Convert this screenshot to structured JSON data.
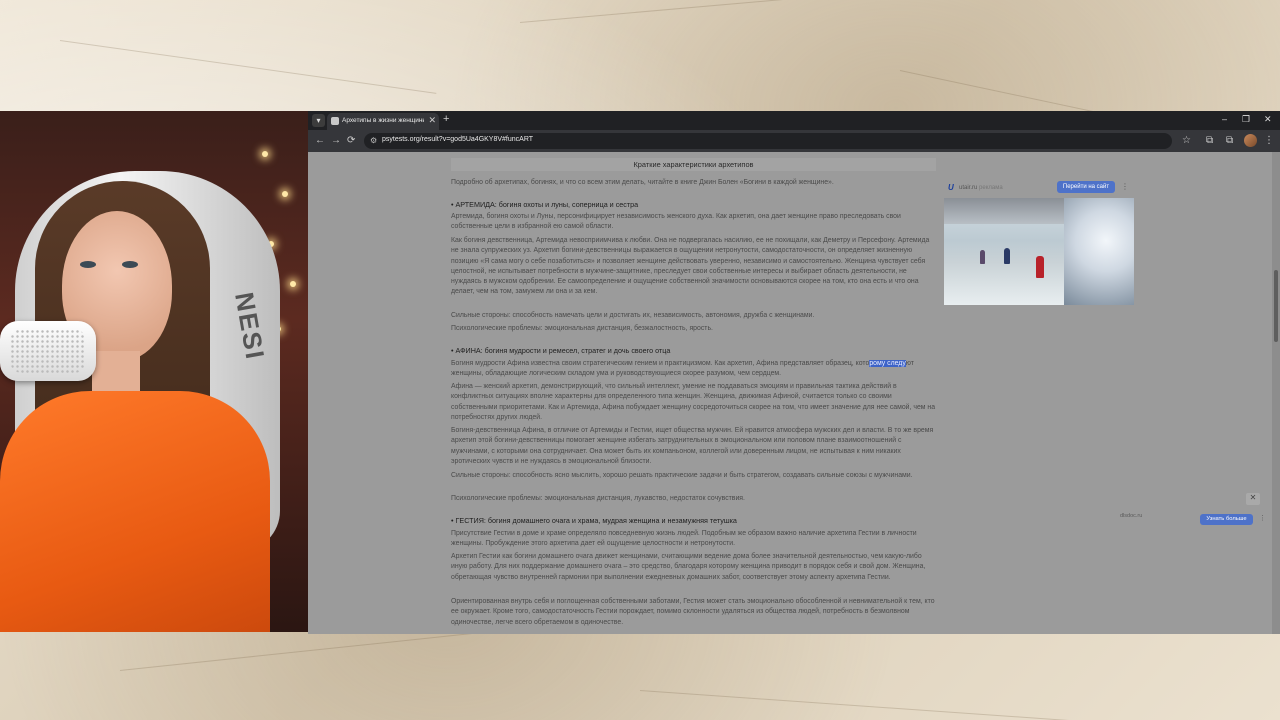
{
  "browser": {
    "tab_title": "Архетипы в жизни женщины...",
    "url": "psytests.org/result?v=god5Ua4GKY8V#funcART"
  },
  "article": {
    "heading": "Краткие характеристики архетипов",
    "intro": "Подробно об архетипах, богинях, и что со всем этим делать, читайте в книге Джин Болен «Богини в каждой женщине».",
    "sections": [
      {
        "title": "• АРТЕМИДА: богиня охоты и луны, соперница и сестра",
        "paragraphs": [
          "Артемида, богиня охоты и Луны, персонифицирует независимость женского духа. Как архетип, она дает женщине право преследовать свои собственные цели в избранной ею самой области.",
          "Как богиня девственница, Артемида невосприимчива к любви. Она не подвергалась насилию, ее не похищали, как Деметру и Персефону. Артемида не знала супружеских уз. Архетип богини-девственницы выражается в ощущении нетронутости, самодостаточности, он определяет жизненную позицию «Я сама могу о себе позаботиться» и позволяет женщине действовать уверенно, независимо и самостоятельно. Женщина чувствует себя целостной, не испытывает потребности в мужчине-защитнике, преследует свои собственные интересы и выбирает область деятельности, не нуждаясь в мужском одобрении. Ее самоопределение и ощущение собственной значимости основываются скорее на том, кто она есть и что она делает, чем на том, замужем ли она и за кем.",
          "Сильные стороны: способность намечать цели и достигать их, независимость, автономия, дружба с женщинами.",
          "Психологические проблемы: эмоциональная дистанция, безжалостность, ярость."
        ]
      },
      {
        "title": "• АФИНА: богиня мудрости и ремесел, стратег и дочь своего отца",
        "paragraphs": [
          "Богиня мудрости Афина известна своим стратегическим гением и практицизмом. Как архетип, Афина представляет образец, которому следуют женщины, обладающие логическим складом ума и руководствующиеся скорее разумом, чем сердцем.",
          "Афина — женский архетип, демонстрирующий, что сильный интеллект, умение не поддаваться эмоциям и правильная тактика действий в конфликтных ситуациях вполне характерны для определенного типа женщин. Женщина, движимая Афиной, считается только со своими собственными приоритетами. Как и Артемида, Афина побуждает женщину сосредоточиться скорее на том, что имеет значение для нее самой, чем на потребностях других людей.",
          "Богиня-девственница Афина, в отличие от Артемиды и Гестии, ищет общества мужчин. Ей нравится атмосфера мужских дел и власти. В то же время архетип этой богини-девственницы помогает женщине избегать затруднительных в эмоциональном или половом плане взаимоотношений с мужчинами, с которыми она сотрудничает. Она может быть их компаньоном, коллегой или доверенным лицом, не испытывая к ним никаких эротических чувств и не нуждаясь в эмоциональной близости.",
          "Сильные стороны: способность ясно мыслить, хорошо решать практические задачи и быть стратегом, создавать сильные союзы с мужчинами.",
          "Психологические проблемы: эмоциональная дистанция, лукавство, недостаток сочувствия."
        ],
        "highlight_pre": "Богиня мудрости Афина известна своим стратегическим гением и практицизмом. Как архетип, Афина представляет образец, кото",
        "highlight_sel": "рому следу",
        "highlight_post": "ют женщины, обладающие логическим складом ума и руководствующиеся скорее разумом, чем сердцем."
      },
      {
        "title": "• ГЕСТИЯ: богиня домашнего очага и храма, мудрая женщина и незамужняя тетушка",
        "paragraphs": [
          "Присутствие Гестии в доме и храме определяло повседневную жизнь людей. Подобным же образом важно наличие архетипа Гестии в личности женщины. Пробуждение этого архетипа дает ей ощущение целостности и нетронутости.",
          "Архетип Гестии как богини домашнего очага движет женщинами, считающими ведение дома более значительной деятельностью, чем какую-либо иную работу. Для них поддержание домашнего очага – это средство, благодаря которому женщина приводит в порядок себя и свой дом. Женщина, обретающая чувство внутренней гармонии при выполнении ежедневных домашних забот, соответствует этому аспекту архетипа Гестии.",
          "Ориентированная внутрь себя и поглощенная собственными заботами, Гестия может стать эмоционально обособленной и невнимательной к тем, кто ее окружает. Кроме того, самодостаточность Гестии порождает, помимо склонности удаляться из общества людей, потребность в безмолвном одиночестве, легче всего обретаемом в одиночестве."
        ]
      }
    ]
  },
  "ad_top": {
    "domain": "utair.ru",
    "domain_sub": "реклама",
    "button": "Перейти на сайт",
    "menu": "⋮",
    "logo": "U"
  },
  "ad_bottom": {
    "close": "✕",
    "domain": "dlsdoc.ru",
    "button": "Узнать больше",
    "menu": "⋮"
  },
  "icons": {
    "back": "←",
    "forward": "→",
    "reload": "⟳",
    "site_info": "⚙",
    "star": "☆",
    "extensions": "⧉",
    "menu": "⋮",
    "new_tab": "+",
    "close": "✕",
    "minimize": "–",
    "maximize": "❐"
  }
}
